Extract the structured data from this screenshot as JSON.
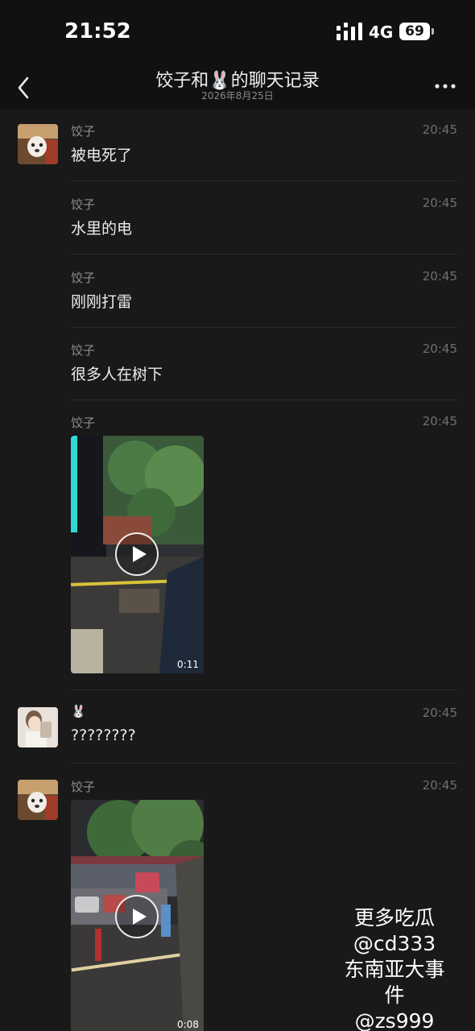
{
  "status_bar": {
    "time": "21:52",
    "network": "4G",
    "battery": "69"
  },
  "header": {
    "title": "饺子和🐰的聊天记录",
    "subtitle": "2026年8月25日"
  },
  "messages": [
    {
      "sender": "饺子",
      "time": "20:45",
      "text": "被电死了"
    },
    {
      "sender": "饺子",
      "time": "20:45",
      "text": "水里的电"
    },
    {
      "sender": "饺子",
      "time": "20:45",
      "text": "刚刚打雷"
    },
    {
      "sender": "饺子",
      "time": "20:45",
      "text": "很多人在树下"
    },
    {
      "sender": "饺子",
      "time": "20:45",
      "video_duration": "0:11"
    },
    {
      "sender": "🐰",
      "time": "20:45",
      "text": "????????"
    },
    {
      "sender": "饺子",
      "time": "20:45",
      "video_duration": "0:08"
    }
  ],
  "watermark": {
    "line1": "更多吃瓜",
    "line2": "@cd333",
    "line3": "东南亚大事件",
    "line4": "@zs999"
  },
  "icons": [
    "back-icon",
    "more-icon",
    "play-icon",
    "signal-icon"
  ]
}
